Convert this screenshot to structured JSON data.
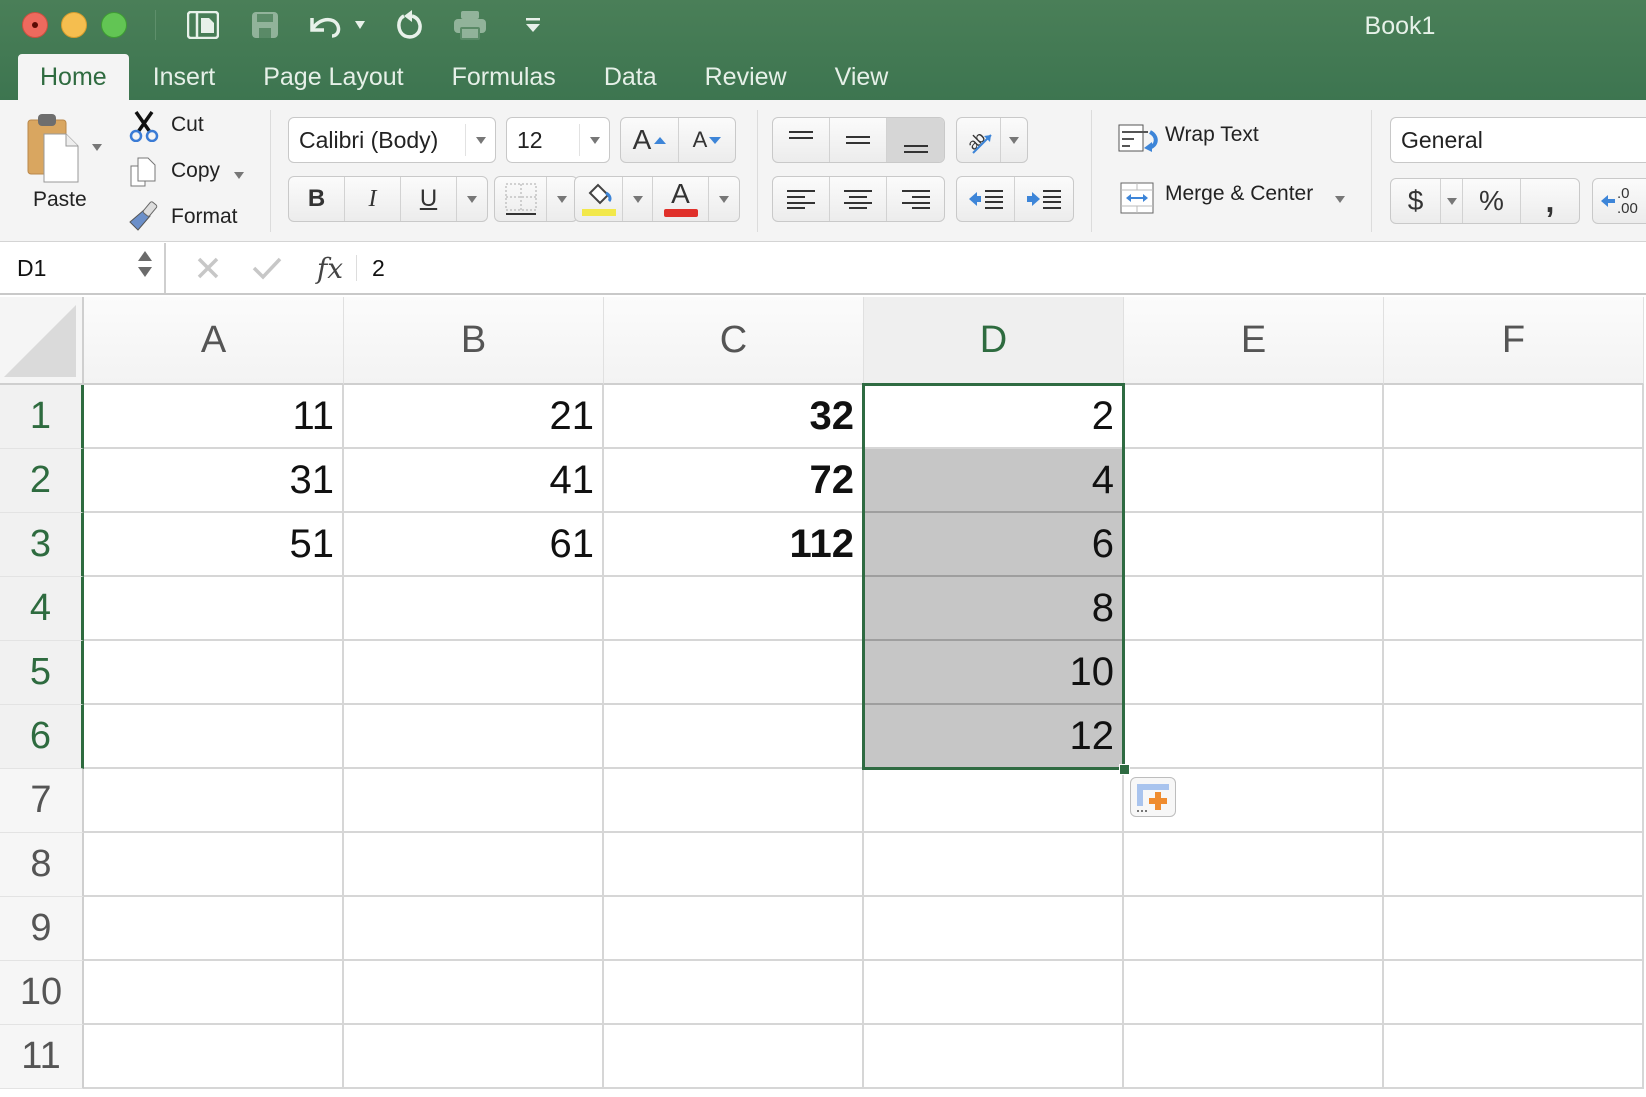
{
  "window": {
    "title": "Book1",
    "traffic_lights": [
      "close",
      "minimize",
      "maximize"
    ]
  },
  "quick_access": {
    "icons": [
      "sidebar-icon",
      "save-icon",
      "undo-icon",
      "undo-dropdown-icon",
      "redo-icon",
      "print-icon",
      "customize-toolbar-icon"
    ]
  },
  "tabs": [
    {
      "label": "Home",
      "active": true
    },
    {
      "label": "Insert",
      "active": false
    },
    {
      "label": "Page Layout",
      "active": false
    },
    {
      "label": "Formulas",
      "active": false
    },
    {
      "label": "Data",
      "active": false
    },
    {
      "label": "Review",
      "active": false
    },
    {
      "label": "View",
      "active": false
    }
  ],
  "ribbon": {
    "clipboard": {
      "paste_label": "Paste",
      "cut_label": "Cut",
      "copy_label": "Copy",
      "format_label": "Format"
    },
    "font": {
      "font_name": "Calibri (Body)",
      "font_size": "12",
      "increase_size_glyph": "A",
      "decrease_size_glyph": "A",
      "bold_glyph": "B",
      "italic_glyph": "I",
      "underline_glyph": "U",
      "font_color_glyph": "A",
      "fill_color": "#f2e84a",
      "font_color": "#e0302a"
    },
    "alignment": {
      "wrap_text_label": "Wrap Text",
      "merge_center_label": "Merge & Center",
      "vertical_align_selected": "bottom"
    },
    "number": {
      "format_value": "General",
      "currency_glyph": "$",
      "percent_glyph": "%",
      "comma_glyph": ",",
      "increase_decimal_top": ".0",
      "increase_decimal_bottom": ".00"
    }
  },
  "formula_bar": {
    "name_box": "D1",
    "fx_label": "fx",
    "value": "2"
  },
  "sheet": {
    "columns": [
      "A",
      "B",
      "C",
      "D",
      "E",
      "F"
    ],
    "selected_column": "D",
    "rows": [
      "1",
      "2",
      "3",
      "4",
      "5",
      "6",
      "7",
      "8",
      "9",
      "10",
      "11"
    ],
    "highlighted_rows": [
      "1",
      "2",
      "3",
      "4",
      "5",
      "6"
    ],
    "cells": {
      "A": [
        "11",
        "31",
        "51",
        "",
        "",
        "",
        "",
        "",
        "",
        "",
        ""
      ],
      "B": [
        "21",
        "41",
        "61",
        "",
        "",
        "",
        "",
        "",
        "",
        "",
        ""
      ],
      "C": [
        "32",
        "72",
        "112",
        "",
        "",
        "",
        "",
        "",
        "",
        "",
        ""
      ],
      "D": [
        "2",
        "4",
        "6",
        "8",
        "10",
        "12",
        "",
        "",
        "",
        "",
        ""
      ],
      "E": [
        "",
        "",
        "",
        "",
        "",
        "",
        "",
        "",
        "",
        "",
        ""
      ],
      "F": [
        "",
        "",
        "",
        "",
        "",
        "",
        "",
        "",
        "",
        "",
        ""
      ]
    },
    "bold_columns": [
      "C"
    ],
    "selection": {
      "range": "D1:D6",
      "active_cell": "D1"
    },
    "accent_color": "#2f6b42",
    "selection_fill": "#c6c6c6"
  }
}
